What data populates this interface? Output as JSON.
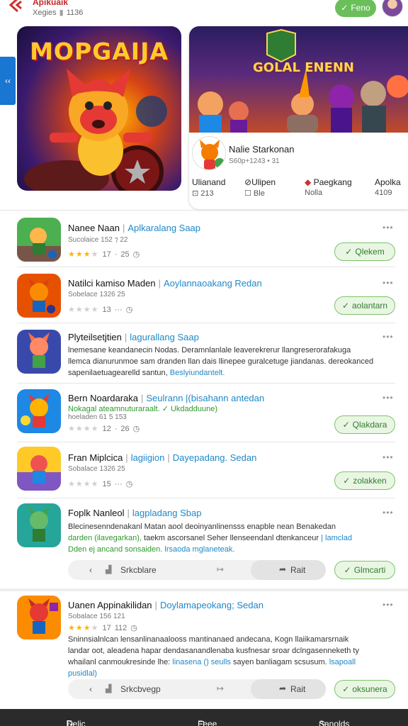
{
  "header": {
    "title": "Apikuaik",
    "subtitle": "Xegies",
    "count": "1136",
    "button_label": "Feno"
  },
  "featured": {
    "left_title": "MOPGAIJA",
    "right_title": "GOLAL ENENN",
    "app_name": "Nalie Starkonan",
    "app_sub": "S60p+1243 • 31",
    "stats": [
      {
        "label": "Ulianand",
        "sub": "213",
        "icon": "square-icon"
      },
      {
        "label": "Ulipen",
        "sub": "Ble",
        "icon": "clip-icon"
      },
      {
        "label": "Paegkang",
        "sub": "Nolla",
        "icon": "diamond-icon"
      },
      {
        "label": "Apolka",
        "sub": "4109",
        "icon": ""
      }
    ]
  },
  "list": [
    {
      "name": "Nanee Naan",
      "category": "Aplkaralang Saap",
      "sub": "Sucolaice 152 ⁊ 22",
      "stars": 3,
      "rating": "17",
      "extra": "25",
      "button": "Qlekem"
    },
    {
      "name": "Natilci kamiso Maden",
      "category": "Aoylannaoakang Redan",
      "sub": "Sobelace 1326 25",
      "stars": 0,
      "rating": "13",
      "extra": "",
      "button": "aolantarn"
    },
    {
      "name": "Plyteilsetjtien",
      "category": "lagurallang Saap",
      "desc1": "lnemesane keandanecin Nodas. Deramnlanlale leaverekrerur llangreserorafakuga",
      "desc2": "llemca dianurunmoe sam dranden llan dais llinepee guralcetuge jiandanas. dereokanced",
      "desc3": "sapenilaetuagearelld santun,",
      "desc3_hl": "Beslyiundantelt."
    },
    {
      "name": "Bern Noardaraka",
      "category": "Seulrann |(bisahann antedan",
      "green": "Nokagal ateamnuturaraalt.",
      "green2": "Ukdadduune)",
      "sub": "hoeladen 61 5 153",
      "stars": 0,
      "rating": "12",
      "extra": "26",
      "button": "Qlakdara"
    },
    {
      "name": "Fran Miplcica",
      "category": "lagiigion",
      "category2": "Dayepadang. Sedan",
      "sub": "Sobalace 1326 25",
      "stars": 0,
      "rating": "15",
      "extra": "",
      "button": "zolakken"
    },
    {
      "name": "Foplk Nanleol",
      "category": "lagpladang Sbap",
      "desc1": "Blecinesenndenakanl Matan aool deoinyanlinensss enapble nean Benakedan",
      "desc2_hl": "darden (ilavegarkan),",
      "desc2": "taekm ascorsanel Seher llenseendanl dtenkanceur",
      "desc2_hl2": "lamclad",
      "desc3_hl": "Dden ej ancand sonsaiden.",
      "desc3_hl2": "lrsaoda mglaneteak.",
      "bar_label": "Srkcblare",
      "bar_right": "Rait",
      "button": "Glmcarti"
    },
    {
      "name": "Uanen Appinakilidan",
      "category": "Doylamapeokang; Sedan",
      "sub": "Sobalace 156 121",
      "stars": 3,
      "rating": "17",
      "extra": "112",
      "desc1": "Sninnsialnlcan lensanlinanaalooss mantinanaed andecana, Kogn llaiikamarsrnaik",
      "desc2": "landar oot, aleadena hapar dendasanandlenaba kusfnesar sroar dclngasenneketh ty",
      "desc3": "whailanl canmoukresinde lhe:",
      "desc3_hl": "linasena () seulls",
      "desc3b": "sayen banliagam scsusum.",
      "desc3_hl2": "lsapoall",
      "desc4_hl": "pusidlal)",
      "bar_label": "Srkcbvegp",
      "bar_right": "Rait",
      "button": "oksunera"
    }
  ],
  "bottom": {
    "left": "Delic",
    "mid": "Feee",
    "right": "Sanolds Dreame"
  }
}
